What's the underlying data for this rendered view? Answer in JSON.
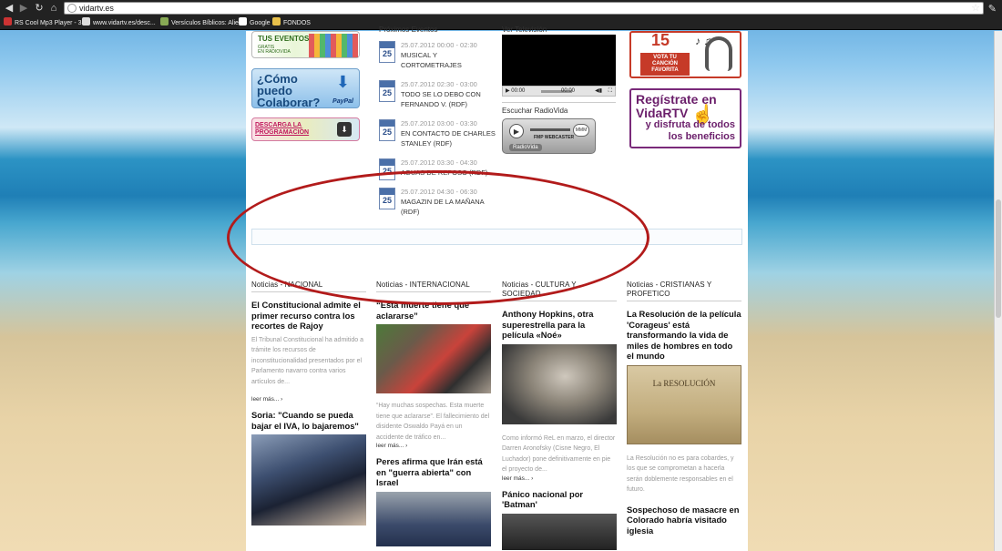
{
  "browser": {
    "url": "vidartv.es",
    "back_label": "◀",
    "forward_label": "▶",
    "reload_label": "↻",
    "home_label": "⌂",
    "bookmarks": [
      {
        "label": "RS Cool Mp3 Player - 3...",
        "color": "#c33"
      },
      {
        "label": "www.vidartv.es/desc...",
        "color": "#ddd"
      },
      {
        "label": "Versículos Bíblicos: Alie...",
        "color": "#8a5"
      },
      {
        "label": "Google",
        "color": "#fff"
      },
      {
        "label": "FONDOS",
        "color": "#e8c04a"
      }
    ]
  },
  "left_banners": {
    "eventos": {
      "line1": "TUS EVENTOS",
      "line2": "GRATIS",
      "line3": "EN RADIOVIDA"
    },
    "colaborar": {
      "text": "¿Cómo puedo Colaborar?",
      "paypal": "PayPal"
    },
    "descarga": {
      "text": "DESCARGA LA PROGRAMACIÓN"
    }
  },
  "events": {
    "heading": "Próximos Eventos",
    "items": [
      {
        "day": "25",
        "time": "25.07.2012 00:00 - 02:30",
        "name": "MUSICAL Y CORTOMETRAJES"
      },
      {
        "day": "25",
        "time": "25.07.2012 02:30 - 03:00",
        "name": "TODO SE LO DEBO CON FERNANDO V. (RDF)"
      },
      {
        "day": "25",
        "time": "25.07.2012 03:00 - 03:30",
        "name": "EN CONTACTO DE CHARLES STANLEY (RDF)"
      },
      {
        "day": "25",
        "time": "25.07.2012 03:30 - 04:30",
        "name": "AGUAS DE REPOSO (RDF)"
      },
      {
        "day": "25",
        "time": "25.07.2012 04:30 - 06:30",
        "name": "MAGAZIN DE LA MAÑANA (RDF)"
      }
    ]
  },
  "media": {
    "tv_heading": "Ver Televisión",
    "time_elapsed": "00:00",
    "time_total": "00:00",
    "radio_heading": "Escuchar RadioVida",
    "radio_label": "RadioVida",
    "radio_brand": "FMP WEBCASTER",
    "radio_vol": "MMM"
  },
  "right_banners": {
    "top40": {
      "vote": "VOTA TU CANCIÓN FAVORITA",
      "num": "15"
    },
    "registrate": {
      "line1": "Regístrate en VidaRTV",
      "line2": "y disfruta de todos los beneficios"
    }
  },
  "news": {
    "col1": {
      "heading": "Noticias - NACIONAL",
      "a1_title": "El Constitucional admite el primer recurso contra los recortes de Rajoy",
      "a1_body": "El Tribunal Constitucional ha admitido a trámite los recursos de inconstitucionalidad presentados por el Parlamento navarro contra varios artículos de...",
      "a1_more": "leer más... ›",
      "a2_title": "Soria: \"Cuando se pueda bajar el IVA, lo bajaremos\""
    },
    "col2": {
      "heading": "Noticias - INTERNACIONAL",
      "a1_title": "“Esta muerte tiene que aclararse”",
      "a1_body": "“Hay muchas sospechas. Esta muerte tiene que aclararse”. El fallecimiento del disidente Oswaldo Payá en un accidente de tráfico en...",
      "a1_more": "leer más... ›",
      "a2_title": "Peres afirma que Irán está en \"guerra abierta\" con Israel"
    },
    "col3": {
      "heading": "Noticias - CULTURA Y SOCIEDAD",
      "a1_title": "Anthony Hopkins, otra superestrella para la película «Noé»",
      "a1_body": "Como informó ReL en marzo, el director Darren Aronofsky (Cisne Negro, El Luchador) pone definitivamente en pie el proyecto de...",
      "a1_more": "leer más... ›",
      "a2_title": "Pánico nacional por 'Batman'"
    },
    "col4": {
      "heading": "Noticias - CRISTIANAS Y PROFETICO",
      "a1_title": "La Resolución de la película 'Corageus' está transformando la vida de miles de hombres en todo el mundo",
      "a1_image_text": "La RESOLUCIÓN",
      "a1_body": "La Resolución no es para cobardes, y los que se comprometan a hacerla serán doblemente responsables en el futuro.",
      "a2_title": "Sospechoso de masacre en Colorado habría visitado iglesia"
    }
  }
}
